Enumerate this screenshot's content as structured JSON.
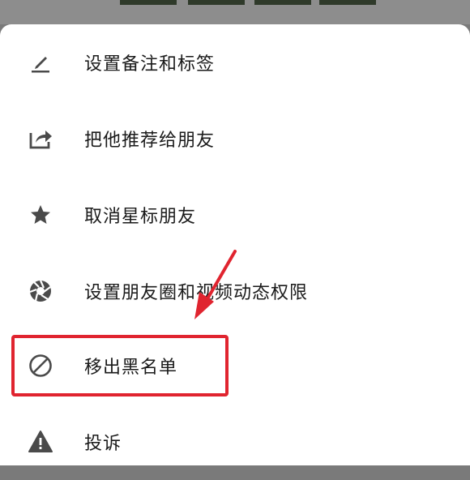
{
  "menu": {
    "items": [
      {
        "label": "设置备注和标签",
        "icon": "pencil-icon"
      },
      {
        "label": "把他推荐给朋友",
        "icon": "share-icon"
      },
      {
        "label": "取消星标朋友",
        "icon": "star-icon"
      },
      {
        "label": "设置朋友圈和视频动态权限",
        "icon": "aperture-icon"
      },
      {
        "label": "移出黑名单",
        "icon": "block-icon"
      },
      {
        "label": "投诉",
        "icon": "warning-icon"
      }
    ]
  },
  "colors": {
    "icon": "#4a4a4a",
    "highlight": "#e0242f",
    "text": "#1a1a1a"
  }
}
